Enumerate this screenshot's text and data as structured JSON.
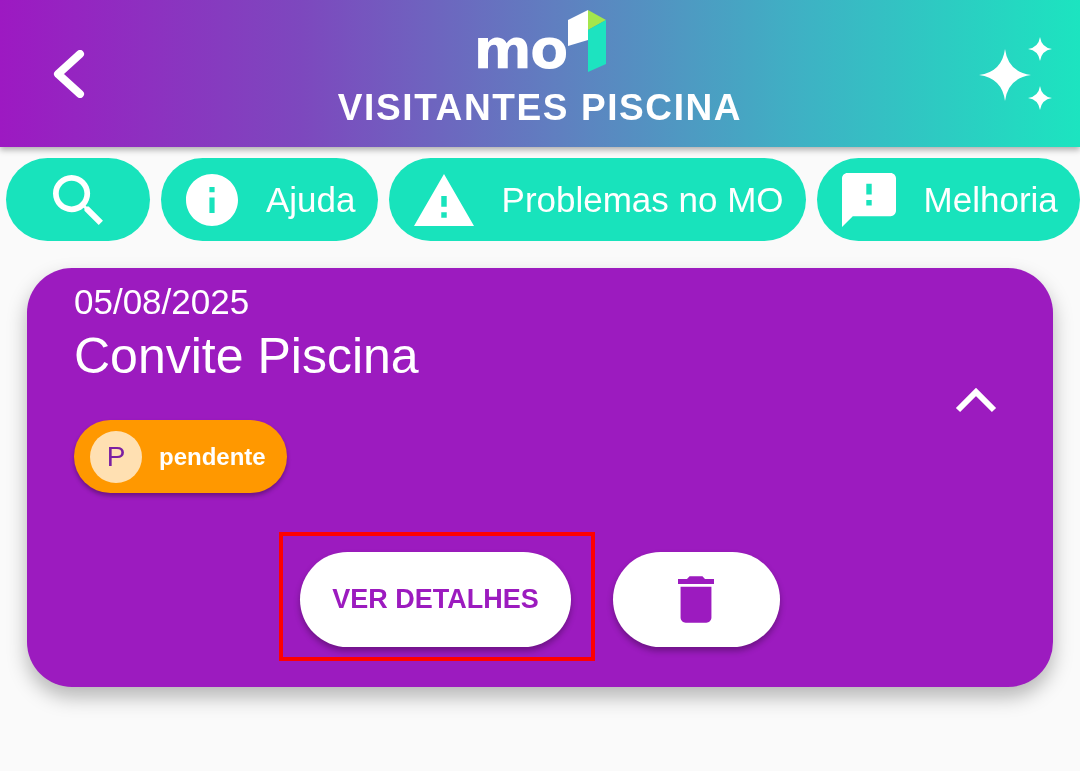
{
  "header": {
    "logo": "mo",
    "title": "VISITANTES PISCINA"
  },
  "chips": [
    {
      "kind": "search"
    },
    {
      "kind": "info",
      "label": "Ajuda"
    },
    {
      "kind": "warning",
      "label": "Problemas no MO"
    },
    {
      "kind": "feedback",
      "label": "Melhoria"
    }
  ],
  "cards": [
    {
      "date": "05/08/2025",
      "title": "Convite Piscina",
      "expanded": true,
      "status": {
        "initial": "P",
        "label": "pendente",
        "color": "#ff9800"
      },
      "actions": [
        {
          "kind": "text",
          "label": "VER DETALHES",
          "highlighted": true
        },
        {
          "kind": "delete",
          "highlighted": false
        }
      ]
    }
  ]
}
